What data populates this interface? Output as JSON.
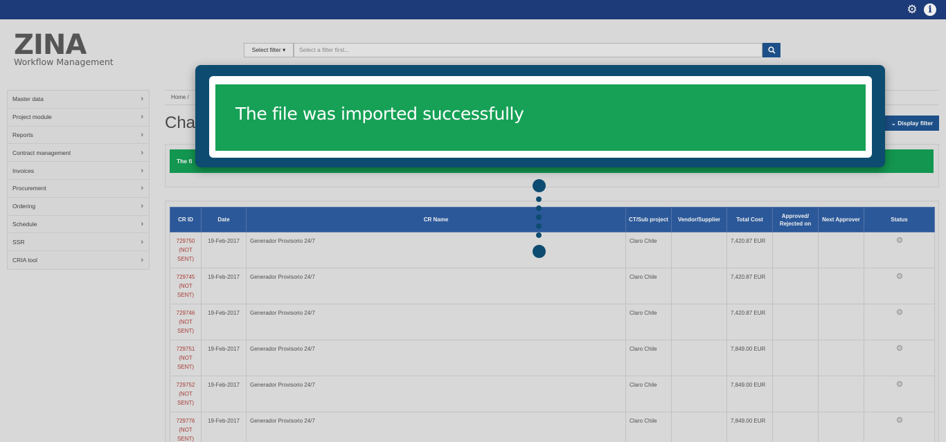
{
  "app": {
    "logo_text": "ZINA",
    "logo_subtitle": "Workflow Management"
  },
  "header": {
    "settings_icon": "gear-icon",
    "info_icon": "info-icon",
    "info_glyph": "i"
  },
  "search": {
    "filter_button": "Select filter ▾",
    "placeholder": "Select a filter first...",
    "search_icon": "search-icon"
  },
  "sidebar": {
    "items": [
      {
        "label": "Master data"
      },
      {
        "label": "Project module"
      },
      {
        "label": "Reports"
      },
      {
        "label": "Contract management"
      },
      {
        "label": "Invoices"
      },
      {
        "label": "Procurement"
      },
      {
        "label": "Ordering"
      },
      {
        "label": "Schedule"
      },
      {
        "label": "SSR"
      },
      {
        "label": "CRIA tool"
      }
    ]
  },
  "main": {
    "breadcrumb": "Home  /",
    "page_title": "Char",
    "display_filter": "⌄ Display filter",
    "alert_text": "The fi"
  },
  "table": {
    "headers": [
      "CR ID",
      "Date",
      "CR Name",
      "CT/Sub project",
      "Vendor/Supplier",
      "Total Cost",
      "Approved/ Rejected on",
      "Next Approver",
      "Status"
    ],
    "rows": [
      {
        "id": "729750",
        "id_note": "(NOT SENT)",
        "date": "19-Feb-2017",
        "name": "Generador Provisorio 24/7",
        "project": "Claro Chile",
        "vendor": "",
        "cost": "7,420.87 EUR",
        "approved": "",
        "next": ""
      },
      {
        "id": "729745",
        "id_note": "(NOT SENT)",
        "date": "19-Feb-2017",
        "name": "Generador Provisorio 24/7",
        "project": "Claro Chile",
        "vendor": "",
        "cost": "7,420.87 EUR",
        "approved": "",
        "next": ""
      },
      {
        "id": "729746",
        "id_note": "(NOT SENT)",
        "date": "19-Feb-2017",
        "name": "Generador Provisorio 24/7",
        "project": "Claro Chile",
        "vendor": "",
        "cost": "7,420.87 EUR",
        "approved": "",
        "next": ""
      },
      {
        "id": "729751",
        "id_note": "(NOT SENT)",
        "date": "19-Feb-2017",
        "name": "Generador Provisorio 24/7",
        "project": "Claro Chile",
        "vendor": "",
        "cost": "7,849.00 EUR",
        "approved": "",
        "next": ""
      },
      {
        "id": "729752",
        "id_note": "(NOT SENT)",
        "date": "19-Feb-2017",
        "name": "Generador Provisorio 24/7",
        "project": "Claro Chile",
        "vendor": "",
        "cost": "7,849.00 EUR",
        "approved": "",
        "next": ""
      },
      {
        "id": "729776",
        "id_note": "(NOT SENT)",
        "date": "19-Feb-2017",
        "name": "Generador Provisorio 24/7",
        "project": "Claro Chile",
        "vendor": "",
        "cost": "7,849.00 EUR",
        "approved": "",
        "next": ""
      }
    ]
  },
  "callout": {
    "message": "The file was imported successfully"
  },
  "colors": {
    "topbar": "#1f3f80",
    "accent": "#1f5591",
    "success": "#16a156",
    "callout_frame": "#0d4c70"
  }
}
